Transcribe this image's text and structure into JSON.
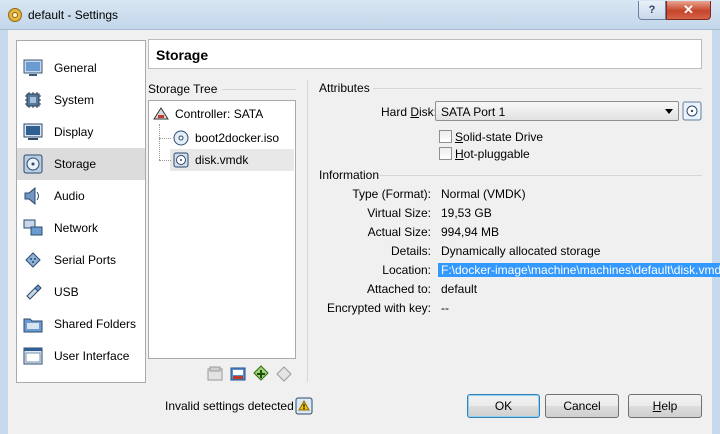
{
  "window": {
    "title": "default - Settings",
    "help_button": "?",
    "close_button": "✕"
  },
  "sidebar": {
    "items": [
      {
        "label": "General",
        "icon": "general-icon"
      },
      {
        "label": "System",
        "icon": "system-chip-icon"
      },
      {
        "label": "Display",
        "icon": "display-monitor-icon"
      },
      {
        "label": "Storage",
        "icon": "storage-disk-icon",
        "selected": true
      },
      {
        "label": "Audio",
        "icon": "speaker-icon"
      },
      {
        "label": "Network",
        "icon": "network-icon"
      },
      {
        "label": "Serial Ports",
        "icon": "serial-port-icon"
      },
      {
        "label": "USB",
        "icon": "usb-icon"
      },
      {
        "label": "Shared Folders",
        "icon": "shared-folder-icon"
      },
      {
        "label": "User Interface",
        "icon": "user-interface-icon"
      }
    ]
  },
  "page": {
    "title": "Storage"
  },
  "storage_tree": {
    "label": "Storage Tree",
    "controller": "Controller: SATA",
    "items": [
      {
        "label": "boot2docker.iso",
        "icon": "optical-disc-icon"
      },
      {
        "label": "disk.vmdk",
        "icon": "hard-disk-icon",
        "selected": true
      }
    ],
    "toolbar": [
      "add-controller-icon",
      "remove-controller-icon",
      "add-attachment-icon",
      "remove-attachment-icon"
    ]
  },
  "attributes": {
    "label": "Attributes",
    "hard_disk_label_pre": "Hard ",
    "hard_disk_label_key": "D",
    "hard_disk_label_post": "isk:",
    "hard_disk_value": "SATA Port 1",
    "ssd_key": "S",
    "ssd_rest": "olid-state Drive",
    "hotplug_key": "H",
    "hotplug_rest": "ot-pluggable",
    "ssd_checked": false,
    "hotplug_checked": false
  },
  "information": {
    "label": "Information",
    "rows": [
      {
        "label": "Type (Format):",
        "value": "Normal (VMDK)"
      },
      {
        "label": "Virtual Size:",
        "value": "19,53 GB"
      },
      {
        "label": "Actual Size:",
        "value": "994,94 MB"
      },
      {
        "label": "Details:",
        "value": "Dynamically allocated storage"
      },
      {
        "label": "Location:",
        "value": "F:\\docker-image\\machine\\machines\\default\\disk.vmdk"
      },
      {
        "label": "Attached to:",
        "value": "default"
      },
      {
        "label": "Encrypted with key:",
        "value": "--"
      }
    ]
  },
  "footer": {
    "status": "Invalid settings detected",
    "ok": "OK",
    "cancel": "Cancel",
    "help_key": "H",
    "help_rest": "elp"
  }
}
